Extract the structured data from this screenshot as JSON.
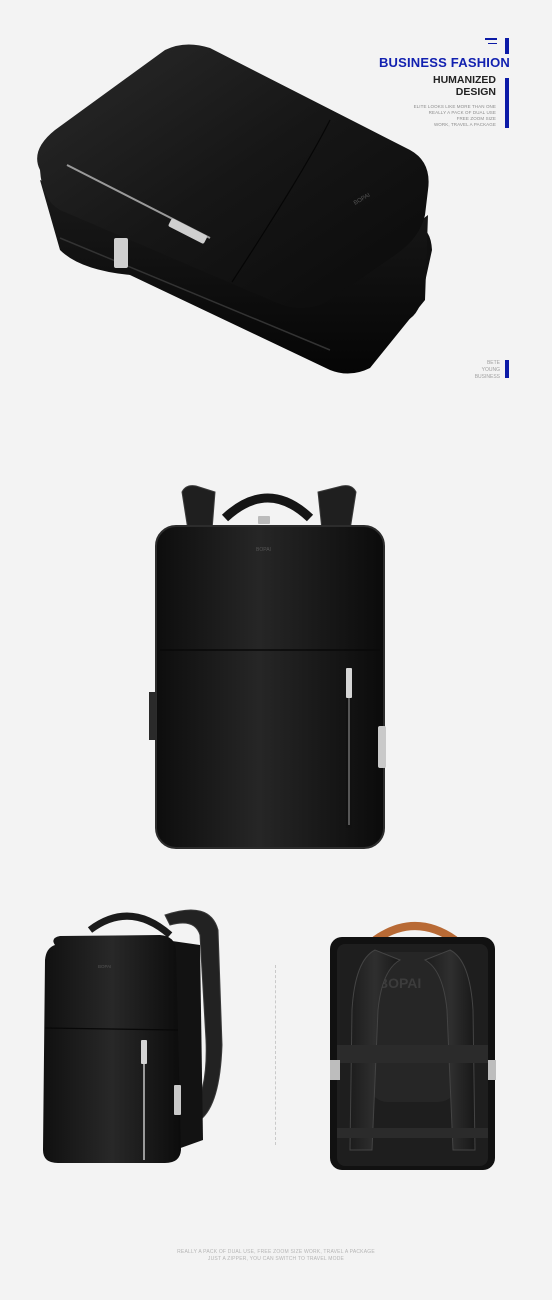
{
  "header": {
    "title": "BUSINESS FASHION",
    "subtitle_line1": "HUMANIZED",
    "subtitle_line2": "DESIGN",
    "small_lines": [
      "ELITE LOOKS LIKE MORE THAN ONE",
      "REALLY A PACK OF DUAL USE",
      "FREE ZOOM SIZE",
      "WORK, TRAVEL A PACKAGE"
    ],
    "accent_color": "#1221b0"
  },
  "mid_note": {
    "lines": [
      "BETE",
      "YOUNG",
      "BUSINESS"
    ]
  },
  "products": [
    {
      "name": "backpack-top-view-image"
    },
    {
      "name": "backpack-front-view-image"
    },
    {
      "name": "backpack-side-view-image"
    },
    {
      "name": "backpack-rear-view-image"
    }
  ],
  "footer": {
    "line1": "REALLY A PACK OF DUAL USE, FREE ZOOM SIZE WORK, TRAVEL A PACKAGE",
    "line2": "JUST A ZIPPER, YOU CAN SWITCH TO TRAVEL MODE"
  }
}
